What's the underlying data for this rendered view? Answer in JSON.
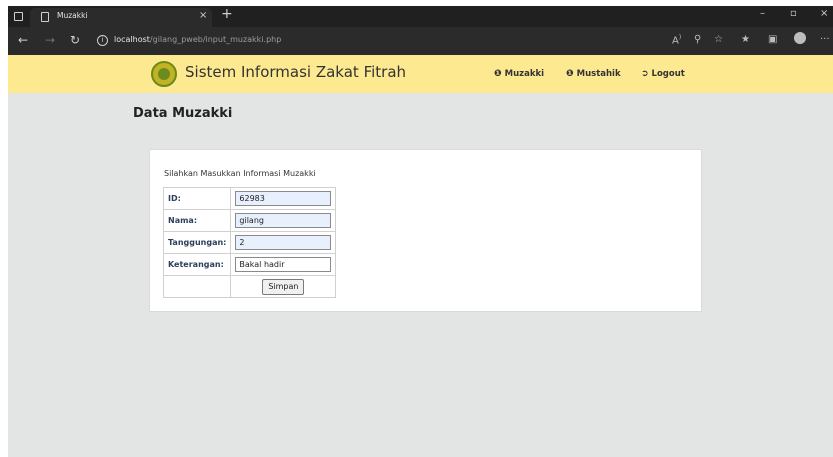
{
  "browser": {
    "tab_title": "Muzakki",
    "tab_close": "×",
    "new_tab": "+",
    "url_host": "localhost",
    "url_path": "/gilang_pweb/input_muzakki.php",
    "win_minimize": "–",
    "win_restore": "▫",
    "win_close": "×",
    "nav_back": "←",
    "nav_forward": "→",
    "nav_refresh": "↻",
    "info_glyph": "i",
    "toolbar_more": "···"
  },
  "header": {
    "site_title": "Sistem Informasi Zakat Fitrah",
    "menu": {
      "muzakki": "Muzakki",
      "mustahik": "Mustahik",
      "logout": "Logout"
    }
  },
  "main": {
    "page_title": "Data Muzakki",
    "form_intro": "Silahkan Masukkan Informasi Muzakki",
    "fields": {
      "id_label": "ID:",
      "id_value": "62983",
      "nama_label": "Nama:",
      "nama_value": "gilang",
      "tanggungan_label": "Tanggungan:",
      "tanggungan_value": "2",
      "keterangan_label": "Keterangan:",
      "keterangan_value": "Bakal hadir"
    },
    "submit_label": "Simpan"
  },
  "colors": {
    "header_bg": "#fde98f",
    "page_bg": "#e3e5e4",
    "label_text": "#2b3f5e",
    "autofill_bg": "#e8f0fe"
  },
  "icons": {
    "user": "user-circle-icon",
    "logout": "logout-icon",
    "logo": "zakat-emblem-icon"
  }
}
